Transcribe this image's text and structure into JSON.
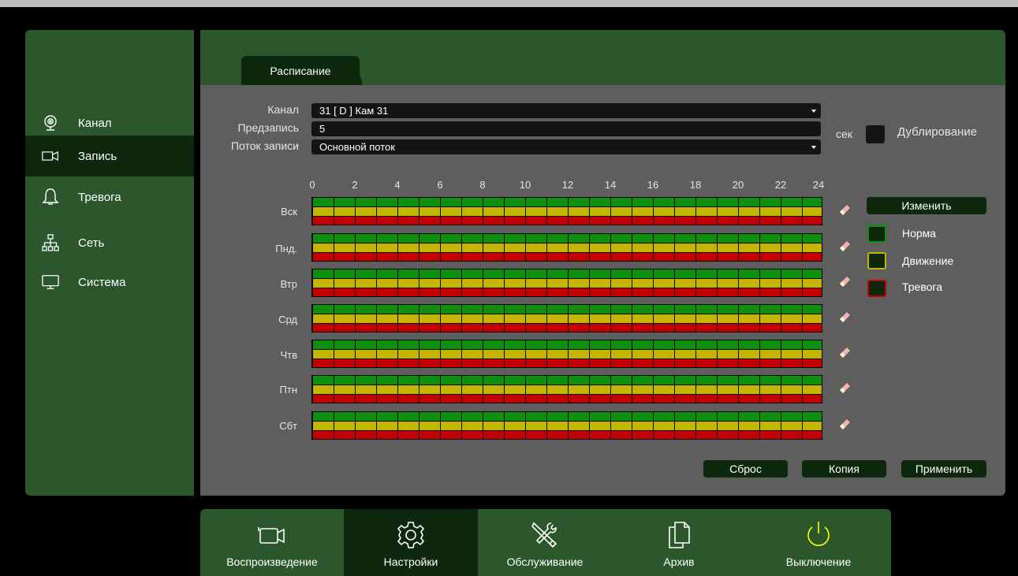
{
  "sidebar": {
    "items": [
      {
        "label": "Канал",
        "icon": "camera-icon"
      },
      {
        "label": "Запись",
        "icon": "video-camera-icon",
        "active": true
      },
      {
        "label": "Тревога",
        "icon": "bell-icon"
      },
      {
        "label": "Сеть",
        "icon": "network-icon"
      },
      {
        "label": "Система",
        "icon": "monitor-icon"
      }
    ]
  },
  "tab": {
    "label": "Расписание"
  },
  "form": {
    "channel_label": "Канал",
    "channel_value": "31 [ D ] Кам 31",
    "prerecord_label": "Предзапись",
    "prerecord_value": "5",
    "prerecord_unit": "сек",
    "stream_label": "Поток записи",
    "stream_value": "Основной поток",
    "duplicate_label": "Дублирование"
  },
  "schedule": {
    "hours": [
      "0",
      "2",
      "4",
      "6",
      "8",
      "10",
      "12",
      "14",
      "16",
      "18",
      "20",
      "22",
      "24"
    ],
    "days": [
      "Вск",
      "Пнд.",
      "Втр",
      "Срд",
      "Чтв",
      "Птн",
      "Сбт"
    ]
  },
  "legend": {
    "edit_label": "Изменить",
    "items": [
      {
        "label": "Норма",
        "color": "#0e8f0e"
      },
      {
        "label": "Движение",
        "color": "#c3b500"
      },
      {
        "label": "Тревога",
        "color": "#c40000"
      }
    ]
  },
  "actions": {
    "reset_label": "Сброс",
    "copy_label": "Копия",
    "apply_label": "Применить"
  },
  "bottom": {
    "items": [
      {
        "label": "Воспроизведение",
        "icon": "playback-camera-icon"
      },
      {
        "label": "Настройки",
        "icon": "gear-icon",
        "active": true
      },
      {
        "label": "Обслуживание",
        "icon": "tools-icon"
      },
      {
        "label": "Архив",
        "icon": "archive-icon"
      },
      {
        "label": "Выключение",
        "icon": "power-icon"
      }
    ]
  },
  "colors": {
    "panel_green": "#2c572c",
    "active_dark": "#0d280d",
    "main_gray": "#5e5e5e"
  }
}
